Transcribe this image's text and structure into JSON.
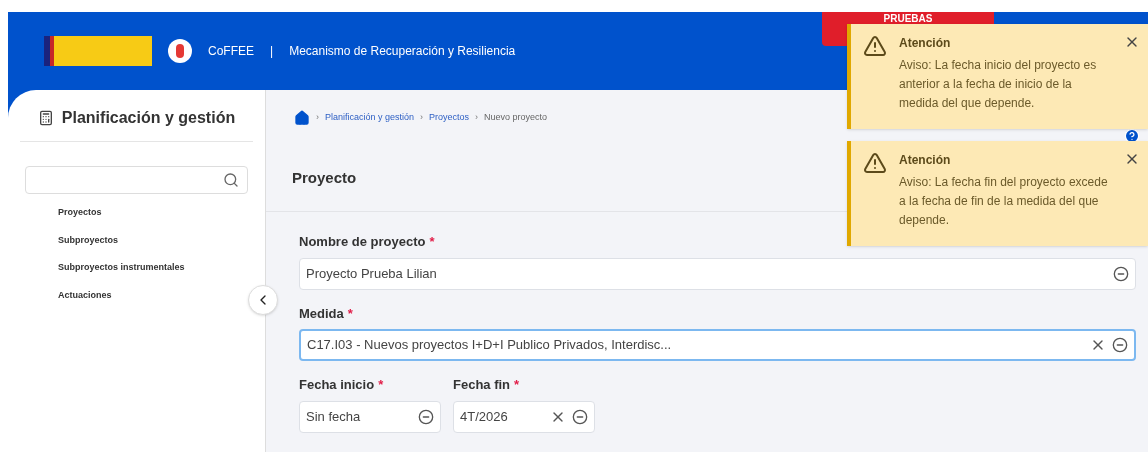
{
  "header": {
    "app_name": "CoFFEE",
    "separator": "|",
    "subtitle": "Mecanismo de Recuperación y Resiliencia",
    "environment": "PRUEBAS"
  },
  "sidebar": {
    "title": "Planificación y gestión",
    "items": [
      {
        "label": "Proyectos",
        "selected": false
      },
      {
        "label": "Subproyectos",
        "selected": false
      },
      {
        "label": "Subproyectos instrumentales",
        "selected": false
      },
      {
        "label": "Actuaciones",
        "selected": false
      }
    ]
  },
  "breadcrumb": [
    {
      "separator": "›",
      "label": "Planificación y gestión",
      "link": true
    },
    {
      "separator": "›",
      "label": "Proyectos",
      "link": true
    },
    {
      "separator": "›",
      "label": "Nuevo proyecto",
      "link": false
    }
  ],
  "page_title": "Proyecto",
  "form": {
    "fields": [
      {
        "label": "Nombre de proyecto",
        "required_mark": "*",
        "value": "Proyecto Prueba Lilian",
        "clearable": false,
        "focused": false
      },
      {
        "label": "Medida",
        "required_mark": "*",
        "value": "C17.I03 - Nuevos proyectos I+D+I Publico Privados, Interdisc...",
        "clearable": true,
        "focused": true
      },
      {
        "label": "Fecha inicio",
        "required_mark": "*",
        "value": "Sin fecha",
        "clearable": false,
        "focused": false
      },
      {
        "label": "Fecha fin",
        "required_mark": "*",
        "value": "4T/2026",
        "clearable": true,
        "focused": false
      }
    ]
  },
  "toasts": [
    {
      "title": "Atención",
      "message": "Aviso: La fecha inicio del proyecto es anterior a la fecha de inicio de la medida del que depende."
    },
    {
      "title": "Atención",
      "message": "Aviso: La fecha fin del proyecto excede a la fecha de fin de la medida del que depende."
    }
  ]
}
